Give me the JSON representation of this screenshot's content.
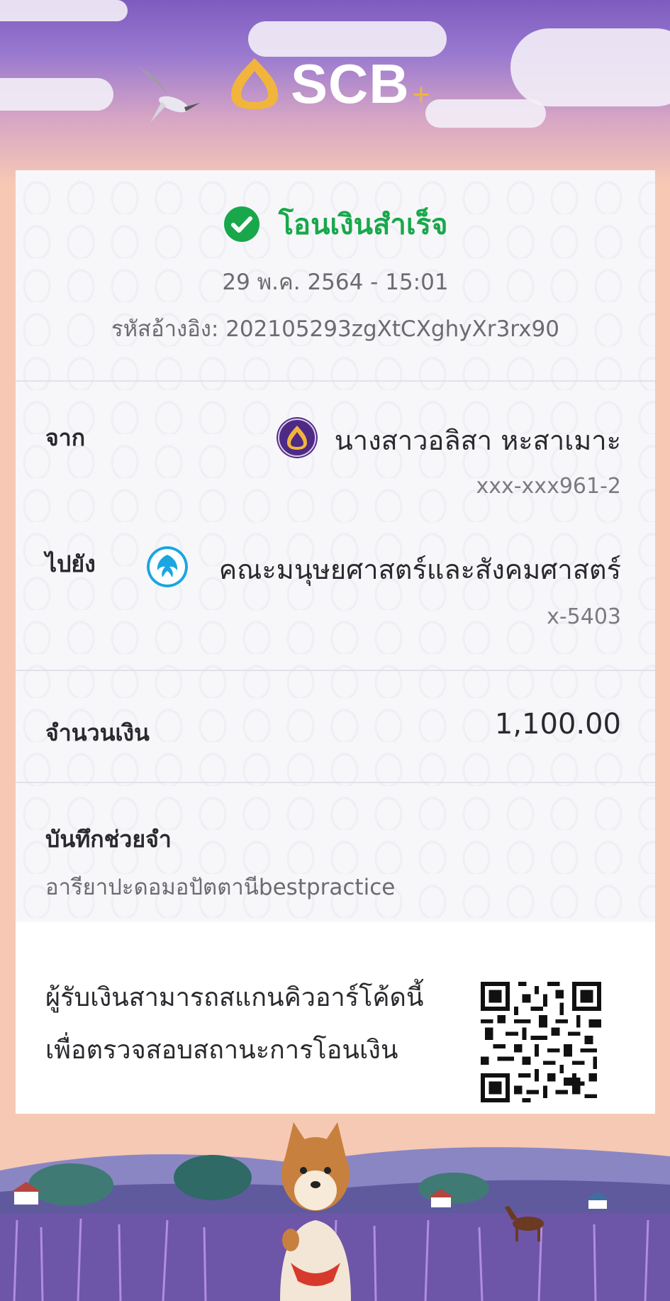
{
  "header": {
    "brand": "SCB",
    "brand_plus": "+"
  },
  "receipt": {
    "status": "โอนเงินสำเร็จ",
    "datetime": "29 พ.ค. 2564 - 15:01",
    "ref_label": "รหัสอ้างอิง:",
    "ref_value": "202105293zgXtCXghyXr3rx90",
    "from": {
      "label": "จาก",
      "name": "นางสาวอลิสา หะสาเมาะ",
      "account": "xxx-xxx961-2",
      "icon": "scb-bank-icon"
    },
    "to": {
      "label": "ไปยัง",
      "name": "คณะมนุษยศาสตร์และสังคมศาสตร์",
      "account": "x-5403",
      "icon": "ktb-bank-icon"
    },
    "amount": {
      "label": "จำนวนเงิน",
      "value": "1,100.00"
    },
    "memo": {
      "label": "บันทึกช่วยจำ",
      "value": "อารียาปะดอมอปัตตานีbestpractice"
    },
    "qr_note": {
      "line1": "ผู้รับเงินสามารถสแกนคิวอาร์โค้ดนี้",
      "line2": "เพื่อตรวจสอบสถานะการโอนเงิน"
    }
  },
  "colors": {
    "success": "#18a84b",
    "scb_purple": "#4e2a84",
    "scb_gold": "#f2b53c",
    "ktb_blue": "#1ba5e1"
  }
}
